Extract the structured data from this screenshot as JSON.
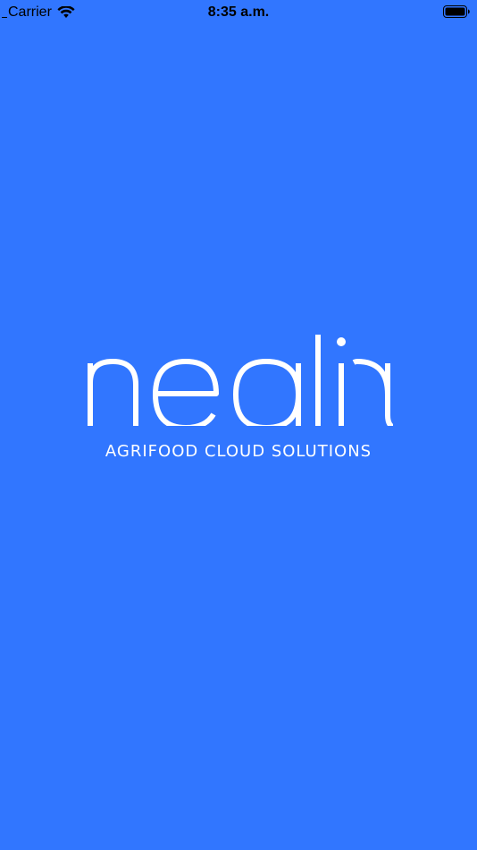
{
  "status_bar": {
    "carrier": "Carrier",
    "time": "8:35 a.m.",
    "wifi_icon": "wifi-icon",
    "battery_icon": "battery-icon"
  },
  "splash": {
    "logo_text": "nealia",
    "tagline": "AGRIFOOD CLOUD SOLUTIONS"
  },
  "colors": {
    "background": "#3176FF",
    "logo": "#FFFFFF",
    "status_text": "#000000"
  }
}
